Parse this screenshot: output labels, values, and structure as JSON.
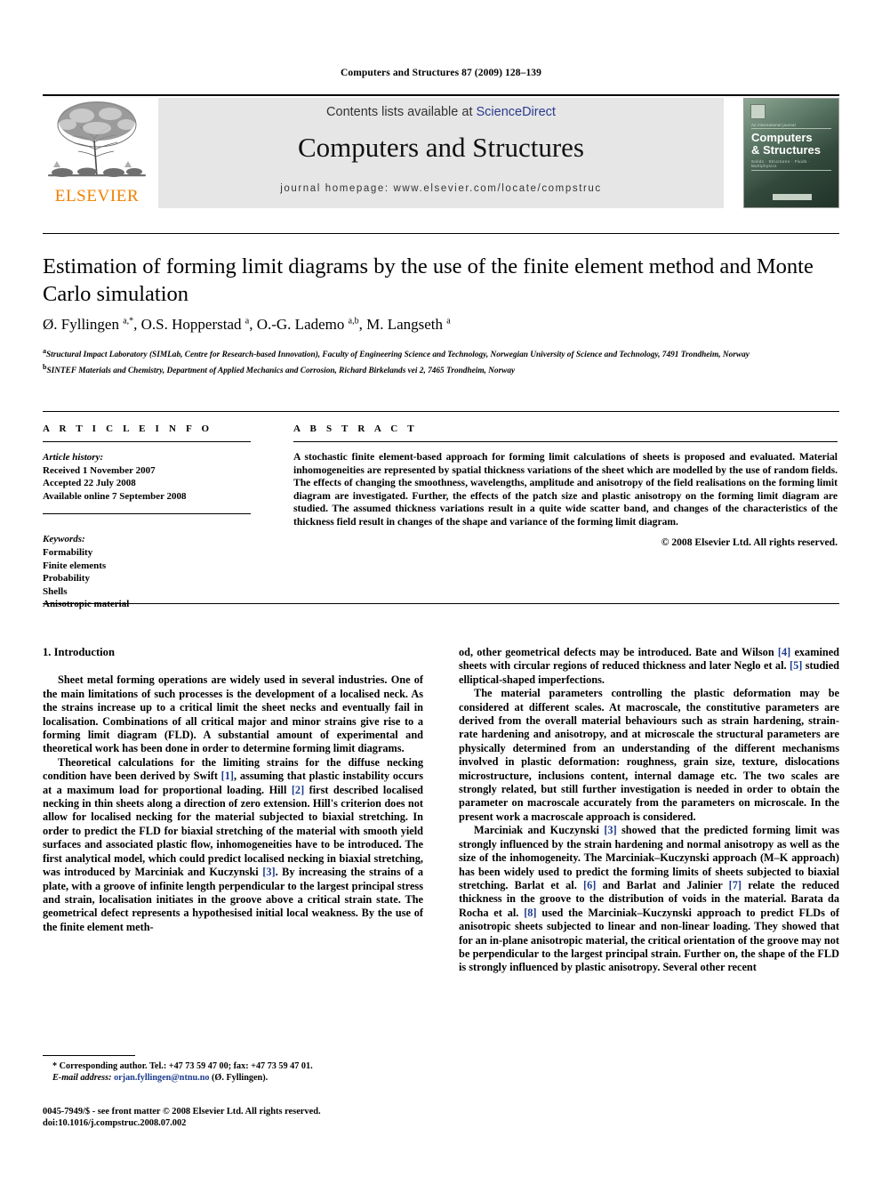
{
  "running_head": "Computers and Structures 87 (2009) 128–139",
  "masthead": {
    "publisher_name": "ELSEVIER",
    "contents_prefix": "Contents lists available at ",
    "contents_link": "ScienceDirect",
    "journal_title": "Computers and Structures",
    "homepage": "journal homepage: www.elsevier.com/locate/compstruc",
    "cover": {
      "tagline": "An international journal",
      "name_line1": "Computers",
      "name_line2": "& Structures",
      "keywords": "Solids  ·  Structures  ·  Fluids  ·  Multiphysics"
    }
  },
  "article": {
    "title": "Estimation of forming limit diagrams by the use of the finite element method and Monte Carlo simulation",
    "authors_html": "Ø. Fyllingen <sup>a,*</sup>, O.S. Hopperstad <sup>a</sup>, O.-G. Lademo <sup>a,b</sup>, M. Langseth <sup>a</sup>",
    "affiliation_a": "Structural Impact Laboratory (SIMLab, Centre for Research-based Innovation), Faculty of Engineering Science and Technology, Norwegian University of Science and Technology, 7491 Trondheim, Norway",
    "affiliation_b": "SINTEF Materials and Chemistry, Department of Applied Mechanics and Corrosion, Richard Birkelands vei 2, 7465 Trondheim, Norway"
  },
  "info": {
    "heading_info": "A R T I C L E  I N F O",
    "heading_abstract": "A B S T R A C T",
    "history_label": "Article history:",
    "history": [
      "Received 1 November 2007",
      "Accepted 22 July 2008",
      "Available online 7 September 2008"
    ],
    "keywords_label": "Keywords:",
    "keywords": [
      "Formability",
      "Finite elements",
      "Probability",
      "Shells",
      "Anisotropic material"
    ]
  },
  "abstract": {
    "text": "A stochastic finite element-based approach for forming limit calculations of sheets is proposed and evaluated. Material inhomogeneities are represented by spatial thickness variations of the sheet which are modelled by the use of random fields. The effects of changing the smoothness, wavelengths, amplitude and anisotropy of the field realisations on the forming limit diagram are investigated. Further, the effects of the patch size and plastic anisotropy on the forming limit diagram are studied. The assumed thickness variations result in a quite wide scatter band, and changes of the characteristics of the thickness field result in changes of the shape and variance of the forming limit diagram.",
    "copyright": "© 2008 Elsevier Ltd. All rights reserved."
  },
  "body": {
    "section_heading": "1. Introduction",
    "left_paragraphs_html": [
      "Sheet metal forming operations are widely used in several industries. One of the main limitations of such processes is the development of a localised neck. As the strains increase up to a critical limit the sheet necks and eventually fail in localisation. Combinations of all critical major and minor strains give rise to a forming limit diagram (FLD). A substantial amount of experimental and theoretical work has been done in order to determine forming limit diagrams.",
      "Theoretical calculations for the limiting strains for the diffuse necking condition have been derived by Swift <span class=\"ref\">[1]</span>, assuming that plastic instability occurs at a maximum load for proportional loading. Hill <span class=\"ref\">[2]</span> first described localised necking in thin sheets along a direction of zero extension. Hill's criterion does not allow for localised necking for the material subjected to biaxial stretching. In order to predict the FLD for biaxial stretching of the material with smooth yield surfaces and associated plastic flow, inhomogeneities have to be introduced. The first analytical model, which could predict localised necking in biaxial stretching, was introduced by Marciniak and Kuczynski <span class=\"ref\">[3]</span>. By increasing the strains of a plate, with a groove of infinite length perpendicular to the largest principal stress and strain, localisation initiates in the groove above a critical strain state. The geometrical defect represents a hypothesised initial local weakness. By the use of the finite element meth-"
    ],
    "right_paragraphs_html": [
      "od, other geometrical defects may be introduced. Bate and Wilson <span class=\"ref\">[4]</span> examined sheets with circular regions of reduced thickness and later Neglo et al. <span class=\"ref\">[5]</span> studied elliptical-shaped imperfections.",
      "The material parameters controlling the plastic deformation may be considered at different scales. At macroscale, the constitutive parameters are derived from the overall material behaviours such as strain hardening, strain-rate hardening and anisotropy, and at microscale the structural parameters are physically determined from an understanding of the different mechanisms involved in plastic deformation: roughness, grain size, texture, dislocations microstructure, inclusions content, internal damage etc. The two scales are strongly related, but still further investigation is needed in order to obtain the parameter on macroscale accurately from the parameters on microscale. In the present work a macroscale approach is considered.",
      "Marciniak and Kuczynski <span class=\"ref\">[3]</span> showed that the predicted forming limit was strongly influenced by the strain hardening and normal anisotropy as well as the size of the inhomogeneity. The Marciniak–Kuczynski approach (M–K approach) has been widely used to predict the forming limits of sheets subjected to biaxial stretching. Barlat et al. <span class=\"ref\">[6]</span> and Barlat and Jalinier <span class=\"ref\">[7]</span> relate the reduced thickness in the groove to the distribution of voids in the material. Barata da Rocha et al. <span class=\"ref\">[8]</span> used the Marciniak–Kuczynski approach to predict FLDs of anisotropic sheets subjected to linear and non-linear loading. They showed that for an in-plane anisotropic material, the critical orientation of the groove may not be perpendicular to the largest principal strain. Further on, the shape of the FLD is strongly influenced by plastic anisotropy. Several other recent"
    ]
  },
  "footnote": {
    "corresponding_html": "* Corresponding author. Tel.: +47 73 59 47 00; fax: +47 73 59 47 01.",
    "email_label": "E-mail address:",
    "email": "orjan.fyllingen@ntnu.no",
    "email_suffix": " (Ø. Fyllingen)."
  },
  "issn_block": {
    "line1": "0045-7949/$ - see front matter © 2008 Elsevier Ltd. All rights reserved.",
    "line2": "doi:10.1016/j.compstruc.2008.07.002"
  }
}
